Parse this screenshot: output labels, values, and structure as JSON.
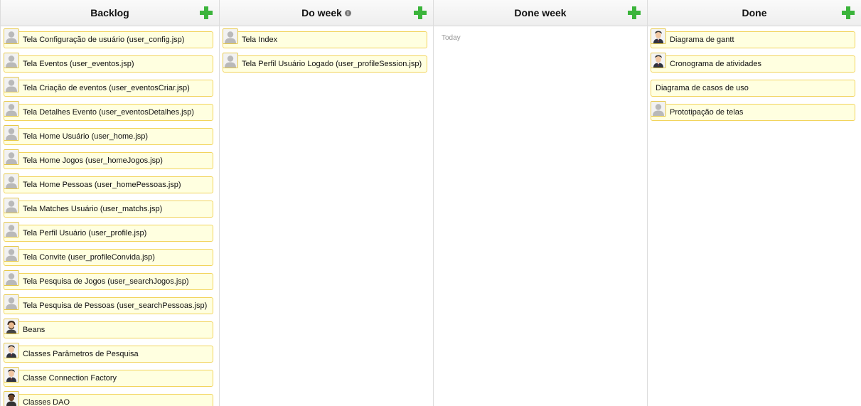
{
  "columns": [
    {
      "title": "Backlog",
      "cards": [
        {
          "label": "Tela Configuração de usuário (user_config.jsp)",
          "avatar": "generic"
        },
        {
          "label": "Tela Eventos (user_eventos.jsp)",
          "avatar": "generic"
        },
        {
          "label": "Tela Criação de eventos (user_eventosCriar.jsp)",
          "avatar": "generic"
        },
        {
          "label": "Tela Detalhes Evento (user_eventosDetalhes.jsp)",
          "avatar": "generic"
        },
        {
          "label": "Tela Home Usuário (user_home.jsp)",
          "avatar": "generic"
        },
        {
          "label": "Tela Home Jogos (user_homeJogos.jsp)",
          "avatar": "generic"
        },
        {
          "label": "Tela Home Pessoas (user_homePessoas.jsp)",
          "avatar": "generic"
        },
        {
          "label": "Tela Matches Usuário (user_matchs.jsp)",
          "avatar": "generic"
        },
        {
          "label": "Tela Perfil Usuário (user_profile.jsp)",
          "avatar": "generic"
        },
        {
          "label": "Tela Convite (user_profileConvida.jsp)",
          "avatar": "generic"
        },
        {
          "label": "Tela Pesquisa de Jogos (user_searchJogos.jsp)",
          "avatar": "generic"
        },
        {
          "label": "Tela Pesquisa de Pessoas (user_searchPessoas.jsp)",
          "avatar": "generic"
        },
        {
          "label": "Beans",
          "avatar": "bearded-man"
        },
        {
          "label": "Classes Parâmetros de Pesquisa",
          "avatar": "man-suit"
        },
        {
          "label": "Classe Connection Factory",
          "avatar": "man-suit"
        },
        {
          "label": "Classes DAO",
          "avatar": "dark-man"
        }
      ]
    },
    {
      "title": "Do week",
      "cards": [
        {
          "label": "Tela Index",
          "avatar": "generic"
        },
        {
          "label": "Tela Perfil Usuário Logado (user_profileSession.jsp)",
          "avatar": "generic"
        }
      ]
    },
    {
      "title": "Done week",
      "today": "Today",
      "cards": []
    },
    {
      "title": "Done",
      "cards": [
        {
          "label": "Diagrama de gantt",
          "avatar": "man-suit"
        },
        {
          "label": "Cronograma de atividades",
          "avatar": "man-suit"
        },
        {
          "label": "Diagrama de casos de uso",
          "avatar": "none"
        },
        {
          "label": "Prototipação de telas",
          "avatar": "generic"
        }
      ]
    }
  ],
  "info_icon_glyph": "i",
  "accent_colors": {
    "plus": "#3bb43b",
    "card_bg": "#ffffe0",
    "card_border": "#f2d45c"
  }
}
